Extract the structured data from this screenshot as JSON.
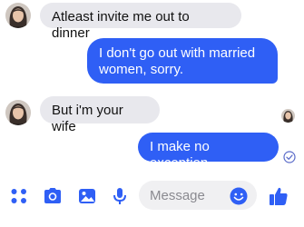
{
  "colors": {
    "accent": "#2f5ff5",
    "incoming_bubble": "#e8e8ed",
    "outgoing_text": "#ffffff",
    "incoming_text": "#111111"
  },
  "conversation": {
    "messages": [
      {
        "direction": "incoming",
        "text": "Atleast invite me out to dinner"
      },
      {
        "direction": "outgoing",
        "text": "I don't go out with married women, sorry."
      },
      {
        "direction": "incoming",
        "text": "But i'm your wife"
      },
      {
        "direction": "outgoing",
        "text": "I make no exception"
      }
    ]
  },
  "composer": {
    "icons": [
      "apps-icon",
      "camera-icon",
      "gallery-icon",
      "microphone-icon",
      "emoji-icon",
      "like-icon"
    ],
    "placeholder": "Message"
  }
}
